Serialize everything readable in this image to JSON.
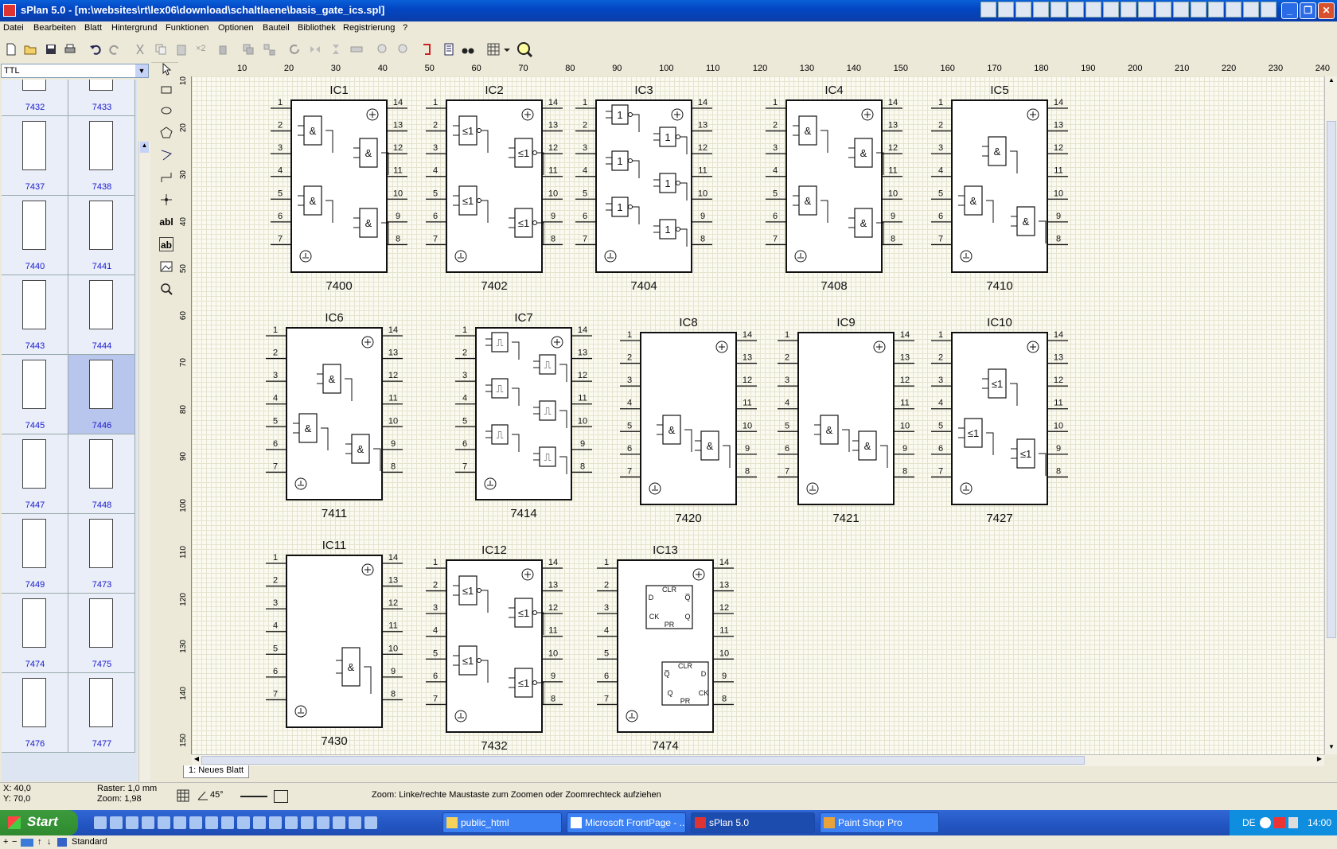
{
  "window": {
    "title": "sPlan 5.0 - [m:\\websites\\rt\\lex06\\download\\schaltlaene\\basis_gate_ics.spl]",
    "controls": [
      "_",
      "❐",
      "✕"
    ]
  },
  "menu": [
    "Datei",
    "Bearbeiten",
    "Blatt",
    "Hintergrund",
    "Funktionen",
    "Optionen",
    "Bauteil",
    "Bibliothek",
    "Registrierung",
    "?"
  ],
  "toolbar": {
    "x2_label": "×2"
  },
  "library": {
    "selected": "TTL",
    "items": [
      "7432",
      "7433",
      "7437",
      "7438",
      "7440",
      "7441",
      "7443",
      "7444",
      "7445",
      "7446",
      "7447",
      "7448",
      "7449",
      "7473",
      "7474",
      "7475",
      "7476",
      "7477"
    ],
    "selected_item": "7446",
    "footer_label": "Standard"
  },
  "tools": {
    "text_tool": "abl",
    "text_box_tool": "ab"
  },
  "ruler": {
    "h_ticks": [
      10,
      20,
      30,
      40,
      50,
      60,
      70,
      80,
      90,
      100,
      110,
      120,
      130,
      140,
      150,
      160,
      170,
      180,
      190,
      200,
      210,
      220,
      230,
      240
    ],
    "v_ticks": [
      10,
      20,
      30,
      40,
      50,
      60,
      70,
      80,
      90,
      100,
      110,
      120,
      130,
      140,
      150
    ]
  },
  "schematic": {
    "ics": [
      {
        "name": "IC1",
        "part": "7400",
        "gate": "&",
        "layout": "quad2"
      },
      {
        "name": "IC2",
        "part": "7402",
        "gate": "≤1",
        "layout": "quad2nor"
      },
      {
        "name": "IC3",
        "part": "7404",
        "gate": "1",
        "layout": "hex"
      },
      {
        "name": "IC4",
        "part": "7408",
        "gate": "&",
        "layout": "quad2"
      },
      {
        "name": "IC5",
        "part": "7410",
        "gate": "&",
        "layout": "tri3"
      },
      {
        "name": "IC6",
        "part": "7411",
        "gate": "&",
        "layout": "tri3"
      },
      {
        "name": "IC7",
        "part": "7414",
        "gate": "⎍",
        "layout": "hex"
      },
      {
        "name": "IC8",
        "part": "7420",
        "gate": "&",
        "layout": "dual4"
      },
      {
        "name": "IC9",
        "part": "7421",
        "gate": "&",
        "layout": "dual4"
      },
      {
        "name": "IC10",
        "part": "7427",
        "gate": "≤1",
        "layout": "tri3"
      },
      {
        "name": "IC11",
        "part": "7430",
        "gate": "&",
        "layout": "single8"
      },
      {
        "name": "IC12",
        "part": "7432",
        "gate": "≤1",
        "layout": "quad2nor"
      },
      {
        "name": "IC13",
        "part": "7474",
        "gate": "FF",
        "layout": "dff"
      }
    ],
    "pins_left": [
      "1",
      "2",
      "3",
      "4",
      "5",
      "6",
      "7"
    ],
    "pins_right": [
      "14",
      "13",
      "12",
      "11",
      "10",
      "9",
      "8"
    ],
    "ff_labels": {
      "clr": "CLR",
      "pr": "PR",
      "d": "D",
      "q": "Q",
      "qbar": "Q̅",
      "ck": "CK"
    }
  },
  "sheet_tab": "1: Neues Blatt",
  "status": {
    "x": "X: 40,0",
    "y": "Y: 70,0",
    "raster": "Raster: 1,0 mm",
    "zoom": "Zoom:  1,98",
    "angle": "45°",
    "hint": "Zoom: Linke/rechte Maustaste zum Zoomen oder Zoomrechteck aufziehen"
  },
  "taskbar": {
    "start": "Start",
    "tasks": [
      "public_html",
      "Microsoft FrontPage - ...",
      "sPlan 5.0",
      "Paint Shop Pro"
    ],
    "active_task": "sPlan 5.0",
    "lang": "DE",
    "clock": "14:00"
  }
}
